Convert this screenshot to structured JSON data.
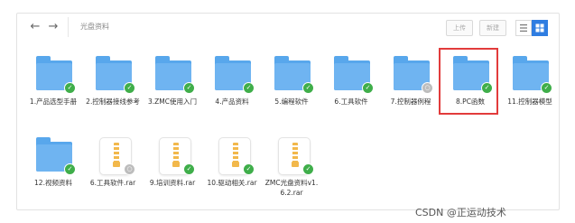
{
  "toolbar": {
    "back_icon": "arrow-left-icon",
    "forward_icon": "arrow-right-icon",
    "breadcrumb": "光盘资料",
    "upload_label": "上传",
    "new_label": "新建",
    "list_view_icon": "list-view-icon",
    "grid_view_icon": "grid-view-icon"
  },
  "items": [
    {
      "label": "1.产品选型手册",
      "type": "folder",
      "status": "synced"
    },
    {
      "label": "2.控制器接线参考",
      "type": "folder",
      "status": "synced"
    },
    {
      "label": "3.ZMC使用入门",
      "type": "folder",
      "status": "synced"
    },
    {
      "label": "4.产品资料",
      "type": "folder",
      "status": "synced"
    },
    {
      "label": "5.编程软件",
      "type": "folder",
      "status": "synced"
    },
    {
      "label": "6.工具软件",
      "type": "folder",
      "status": "synced"
    },
    {
      "label": "7.控制器例程",
      "type": "folder",
      "status": "syncing"
    },
    {
      "label": "8.PC函数",
      "type": "folder",
      "status": "synced"
    },
    {
      "label": "11.控制器模型",
      "type": "folder",
      "status": "synced"
    },
    {
      "label": "12.视频资料",
      "type": "folder",
      "status": "synced"
    },
    {
      "label": "6.工具软件.rar",
      "type": "archive",
      "status": "syncing"
    },
    {
      "label": "9.培训资料.rar",
      "type": "archive",
      "status": "synced"
    },
    {
      "label": "10.驱动相关.rar",
      "type": "archive",
      "status": "synced"
    },
    {
      "label": "ZMC光盘资料v1.6.2.rar",
      "type": "archive",
      "status": "synced"
    }
  ],
  "watermark": "CSDN @正运动技术",
  "colors": {
    "folder": "#58a7ec",
    "badge_ok": "#3fae4a",
    "highlight": "#e23b3b",
    "accent": "#2f7de1"
  }
}
